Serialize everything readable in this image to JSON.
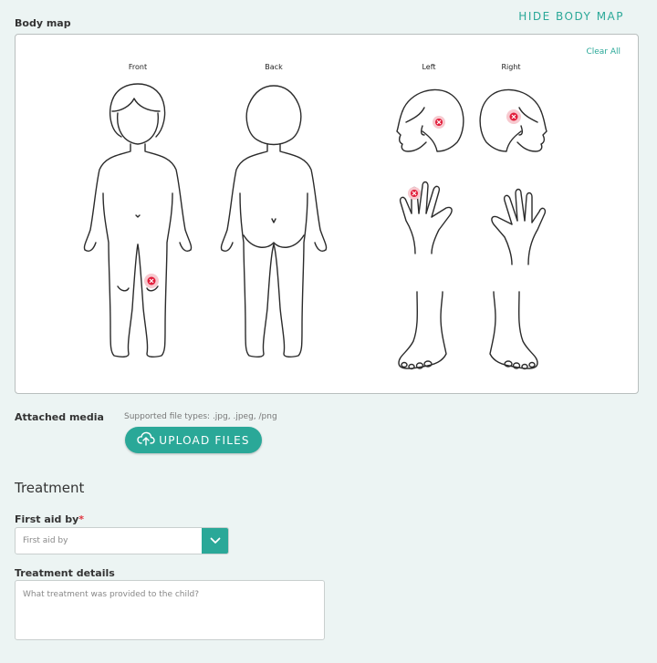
{
  "body_map": {
    "label": "Body map",
    "hide_link": "HIDE BODY MAP",
    "clear_all": "Clear All",
    "views": {
      "front": "Front",
      "back": "Back",
      "left": "Left",
      "right": "Right"
    },
    "marker_color": "#e21d3a",
    "markers": [
      "front-left-knee",
      "left-head-back",
      "left-hand-index-finger",
      "right-head-back"
    ]
  },
  "attached_media": {
    "label": "Attached media",
    "supported_types": "Supported file types: .jpg, .jpeg, /png",
    "upload_button": "UPLOAD FILES",
    "upload_icon": "cloud-upload-icon"
  },
  "treatment": {
    "title": "Treatment",
    "first_aid_label": "First aid by",
    "required_mark": "*",
    "first_aid_placeholder": "First aid by",
    "dropdown_icon": "chevron-down-icon",
    "details_label": "Treatment details",
    "details_placeholder": "What treatment was provided to the child?"
  },
  "colors": {
    "accent": "#2aa898",
    "background": "#ecf4f3",
    "required": "#e0343f"
  }
}
